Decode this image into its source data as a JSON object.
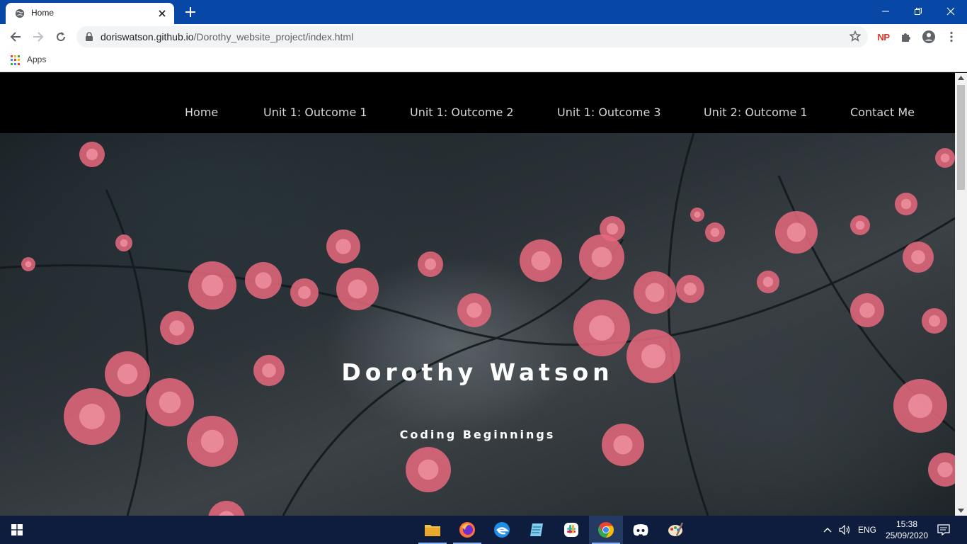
{
  "browser": {
    "tab": {
      "title": "Home"
    },
    "url": {
      "host": "doriswatson.github.io",
      "path": "/Dorothy_website_project/index.html"
    },
    "bookmarks": [
      {
        "label": "Apps"
      }
    ],
    "extension_label": "NP"
  },
  "site": {
    "nav": [
      {
        "label": "Home"
      },
      {
        "label": "Unit 1: Outcome 1"
      },
      {
        "label": "Unit 1: Outcome 2"
      },
      {
        "label": "Unit 1: Outcome 3"
      },
      {
        "label": "Unit 2: Outcome 1"
      },
      {
        "label": "Contact Me"
      }
    ],
    "hero": {
      "title": "Dorothy Watson",
      "subtitle": "Coding Beginnings"
    }
  },
  "taskbar": {
    "apps": [
      "file-explorer",
      "firefox",
      "edge-legacy",
      "notepad-app",
      "slack",
      "chrome",
      "discord",
      "paint"
    ],
    "active_app": "chrome",
    "language": "ENG",
    "time": "15:38",
    "date": "25/09/2020"
  },
  "colors": {
    "tabbar": "#0747a6",
    "taskbar": "#0e1d3d",
    "flower_pink": "#e8687e"
  }
}
